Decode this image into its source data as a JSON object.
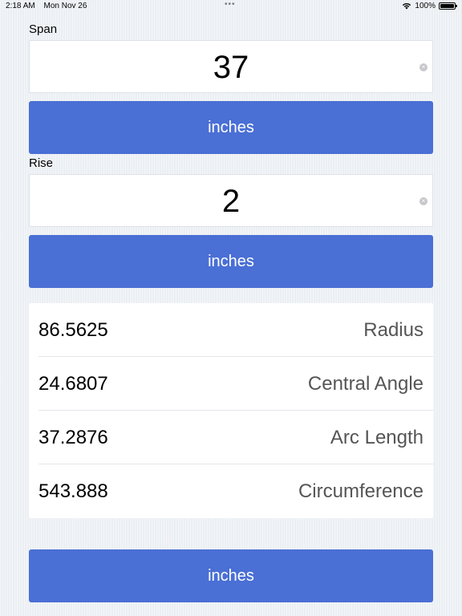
{
  "status_bar": {
    "time": "2:18 AM",
    "date": "Mon Nov 26",
    "center_dots": "•••",
    "battery": "100%"
  },
  "span": {
    "label": "Span",
    "value": "37",
    "unit_button": "inches"
  },
  "rise": {
    "label": "Rise",
    "value": "2",
    "unit_button": "inches"
  },
  "results": [
    {
      "value": "86.5625",
      "name": "Radius"
    },
    {
      "value": "24.6807",
      "name": "Central Angle"
    },
    {
      "value": "37.2876",
      "name": "Arc Length"
    },
    {
      "value": "543.888",
      "name": "Circumference"
    }
  ],
  "output_unit_button": "inches",
  "colors": {
    "accent": "#4a6fd5",
    "background": "#eef2f6"
  }
}
